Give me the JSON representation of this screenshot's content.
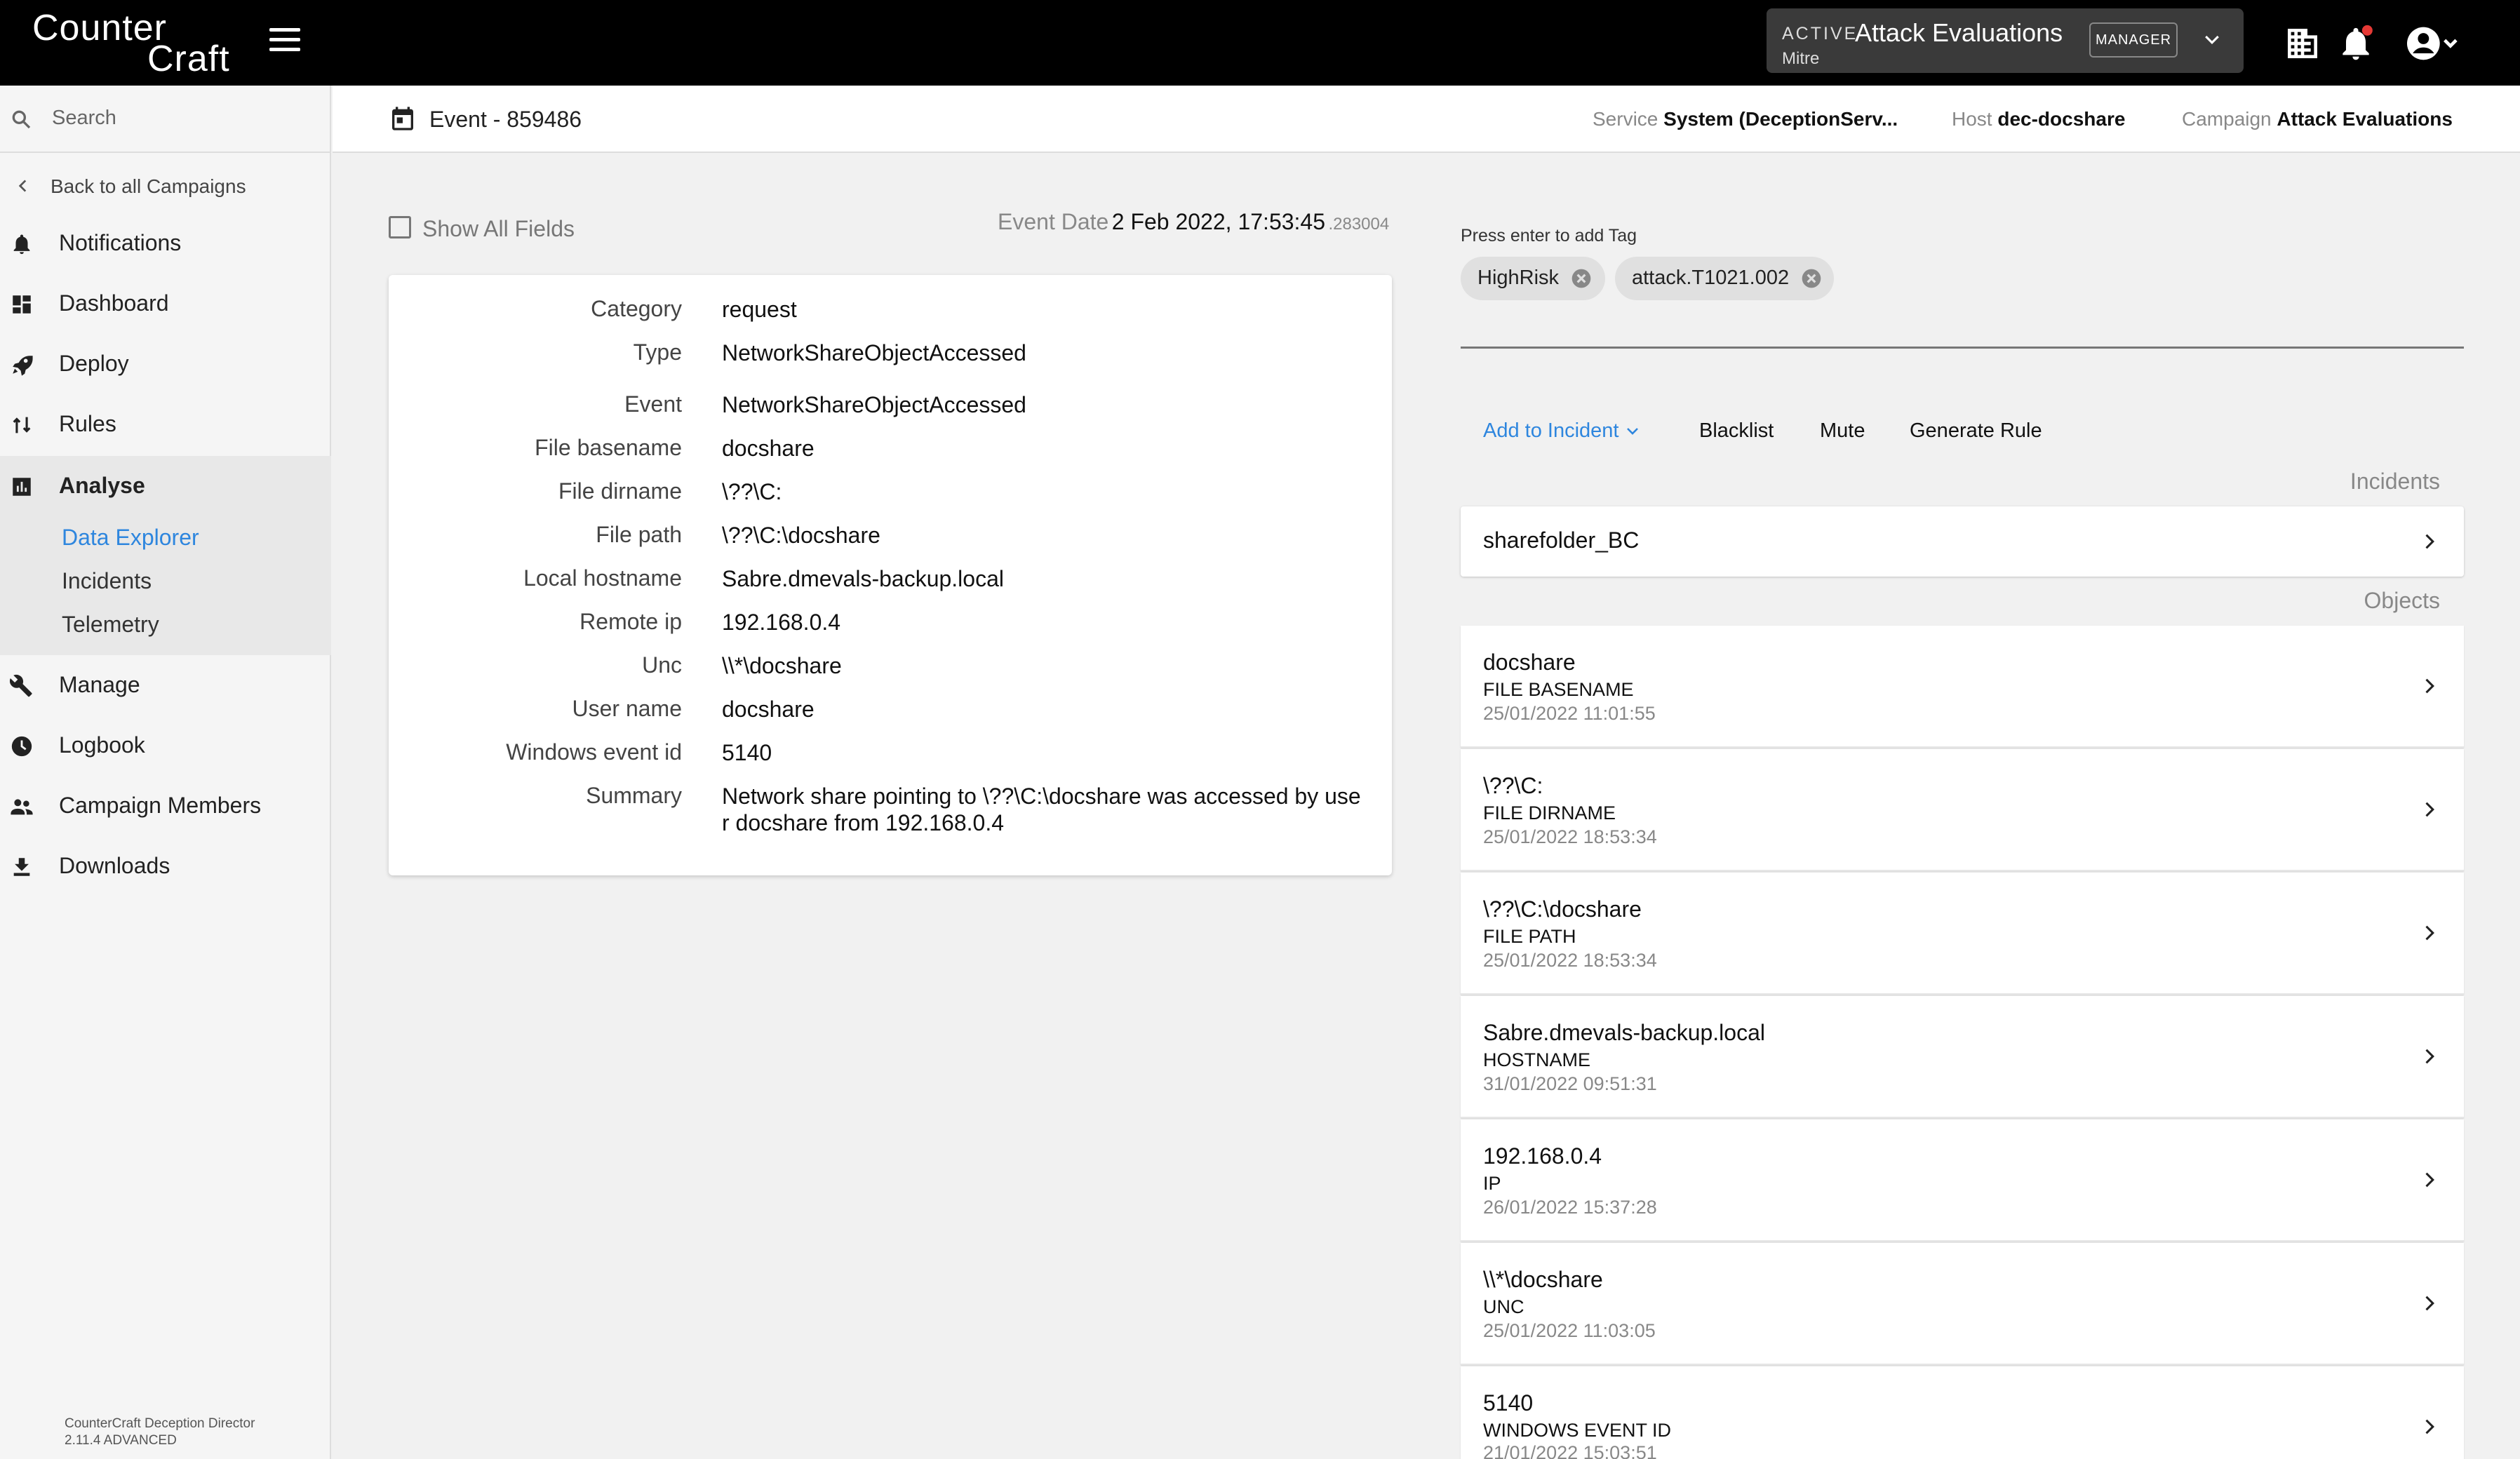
{
  "topbar": {
    "logo_line1": "Counter",
    "logo_line2": "Craft",
    "campaign_status": "ACTIVE",
    "campaign_name": "Attack Evaluations",
    "campaign_sub": "Mitre",
    "role": "MANAGER"
  },
  "sidebar": {
    "search_placeholder": "Search",
    "back": "Back to all Campaigns",
    "items": [
      {
        "label": "Notifications",
        "icon": "bell-icon"
      },
      {
        "label": "Dashboard",
        "icon": "dashboard-icon"
      },
      {
        "label": "Deploy",
        "icon": "rocket-icon"
      },
      {
        "label": "Rules",
        "icon": "rules-icon"
      },
      {
        "label": "Analyse",
        "icon": "chart-icon"
      },
      {
        "label": "Manage",
        "icon": "wrench-icon"
      },
      {
        "label": "Logbook",
        "icon": "clock-icon"
      },
      {
        "label": "Campaign Members",
        "icon": "people-icon"
      },
      {
        "label": "Downloads",
        "icon": "download-icon"
      }
    ],
    "analyse_sub": [
      "Data Explorer",
      "Incidents",
      "Telemetry"
    ],
    "version_line1": "CounterCraft Deception Director",
    "version_line2": "2.11.4 ADVANCED"
  },
  "header": {
    "title": "Event - 859486",
    "service_key": "Service",
    "service_val": "System (DeceptionServ...",
    "host_key": "Host",
    "host_val": "dec-docshare",
    "campaign_key": "Campaign",
    "campaign_val": "Attack Evaluations"
  },
  "event": {
    "show_all": "Show All Fields",
    "date_key": "Event Date",
    "date_val": "2 Feb 2022, 17:53:45",
    "date_ms": ".283004",
    "fields": [
      {
        "k": "Category",
        "v": "request"
      },
      {
        "k": "Type",
        "v": "NetworkShareObjectAccessed"
      },
      {
        "k": "Event",
        "v": "NetworkShareObjectAccessed"
      },
      {
        "k": "File basename",
        "v": "docshare"
      },
      {
        "k": "File dirname",
        "v": "\\??\\C:"
      },
      {
        "k": "File path",
        "v": "\\??\\C:\\docshare"
      },
      {
        "k": "Local hostname",
        "v": "Sabre.dmevals-backup.local"
      },
      {
        "k": "Remote ip",
        "v": "192.168.0.4"
      },
      {
        "k": "Unc",
        "v": "\\\\*\\docshare"
      },
      {
        "k": "User name",
        "v": "docshare"
      },
      {
        "k": "Windows event id",
        "v": "5140"
      },
      {
        "k": "Summary",
        "v": "Network share pointing to \\??\\C:\\docshare was accessed by user docshare from 192.168.0.4"
      }
    ]
  },
  "tags": {
    "hint": "Press enter to add Tag",
    "items": [
      "HighRisk",
      "attack.T1021.002"
    ]
  },
  "actions": {
    "add_incident": "Add to Incident",
    "blacklist": "Blacklist",
    "mute": "Mute",
    "generate_rule": "Generate Rule"
  },
  "incidents": {
    "label": "Incidents",
    "items": [
      "sharefolder_BC"
    ]
  },
  "objects": {
    "label": "Objects",
    "items": [
      {
        "value": "docshare",
        "type": "FILE BASENAME",
        "date": "25/01/2022 11:01:55"
      },
      {
        "value": "\\??\\C:",
        "type": "FILE DIRNAME",
        "date": "25/01/2022 18:53:34"
      },
      {
        "value": "\\??\\C:\\docshare",
        "type": "FILE PATH",
        "date": "25/01/2022 18:53:34"
      },
      {
        "value": "Sabre.dmevals-backup.local",
        "type": "HOSTNAME",
        "date": "31/01/2022 09:51:31"
      },
      {
        "value": "192.168.0.4",
        "type": "IP",
        "date": "26/01/2022 15:37:28"
      },
      {
        "value": "\\\\*\\docshare",
        "type": "UNC",
        "date": "25/01/2022 11:03:05"
      },
      {
        "value": "5140",
        "type": "WINDOWS EVENT ID",
        "date": "21/01/2022 15:03:51"
      }
    ]
  },
  "colors": {
    "accent": "#2e86de",
    "topbar": "#000000",
    "notif_dot": "#e53935"
  }
}
